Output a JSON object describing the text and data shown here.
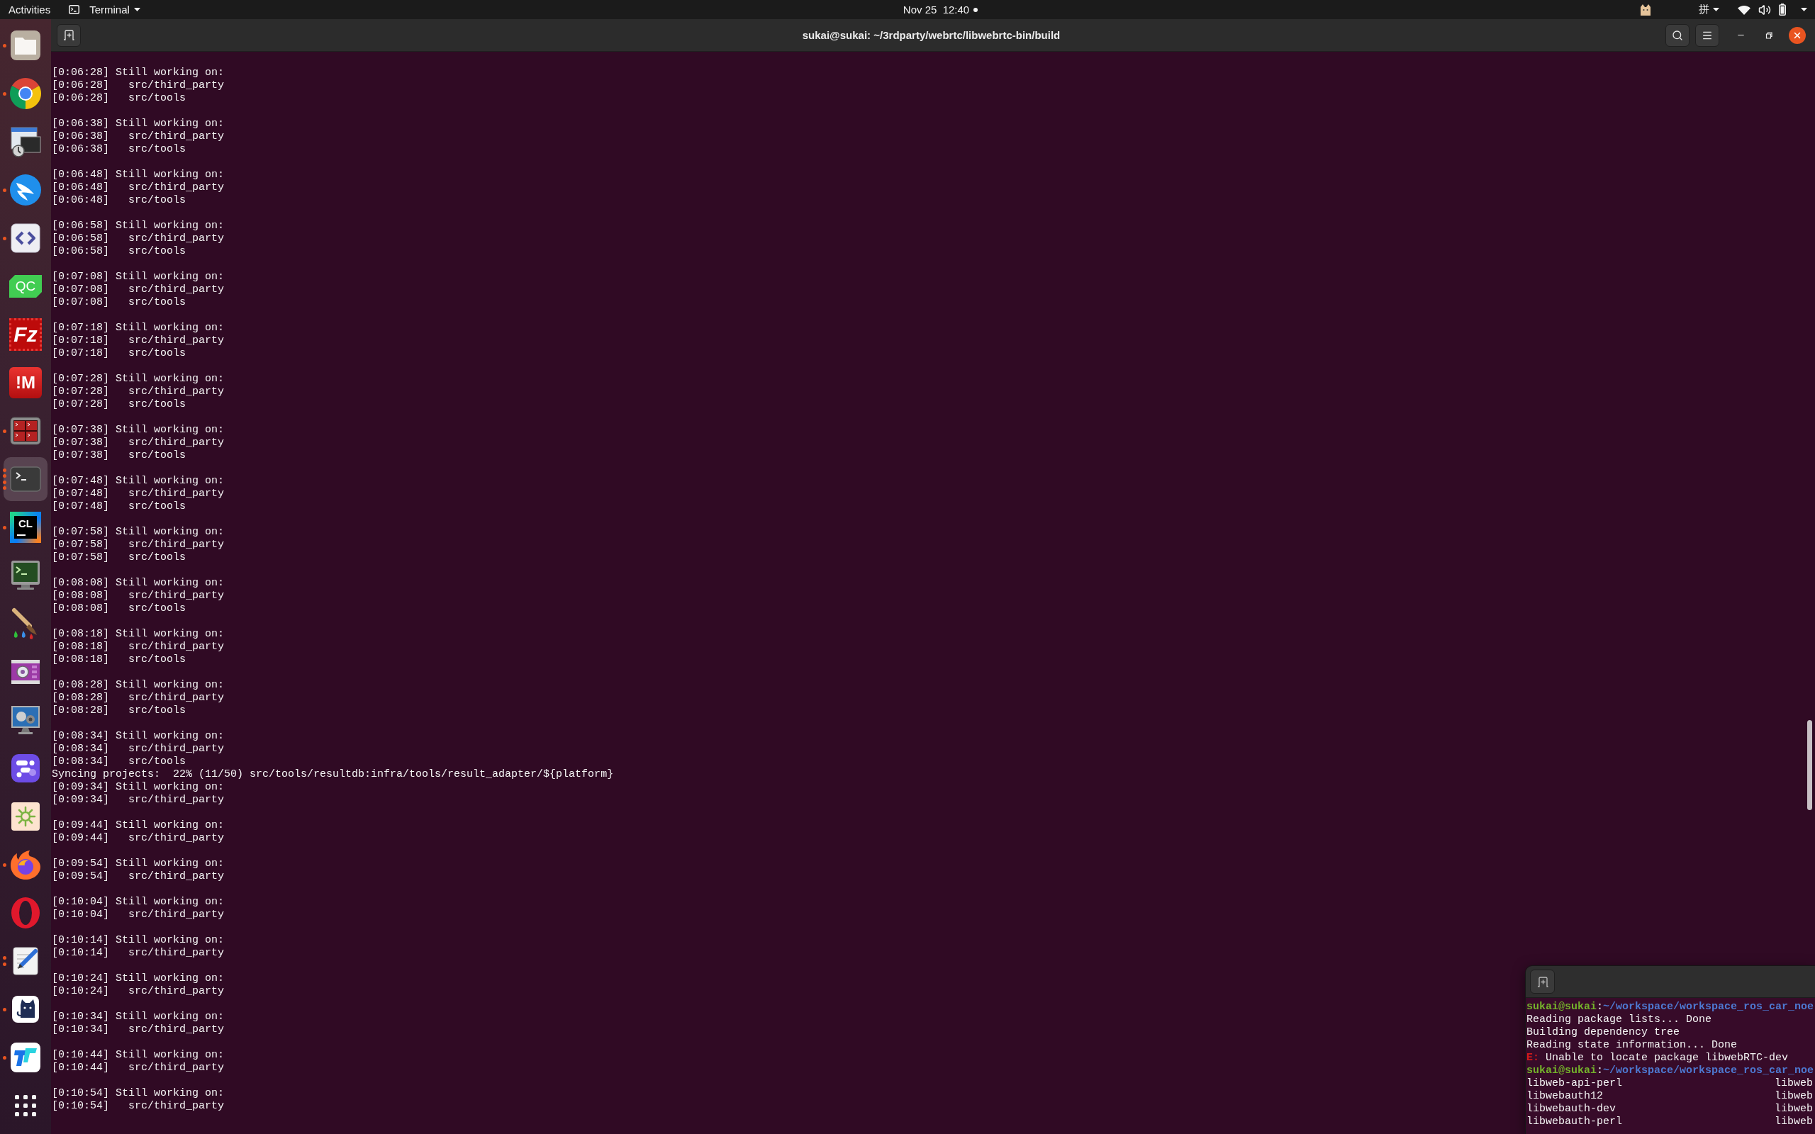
{
  "top_bar": {
    "activities": "Activities",
    "app_menu": "Terminal",
    "clock": "Nov 25  12:40",
    "notifications": true,
    "input_method": "拼"
  },
  "dock": {
    "items": [
      {
        "selected": false,
        "dots": [
          true
        ]
      },
      {
        "selected": false,
        "dots": [
          true
        ]
      },
      {
        "selected": false,
        "dots": [
          false
        ]
      },
      {
        "selected": false,
        "dots": [
          true
        ]
      },
      {
        "selected": false,
        "dots": [
          true
        ]
      },
      {
        "logo": "QC",
        "selected": false,
        "dots": [
          false
        ]
      },
      {
        "logo": "Fz",
        "selected": false,
        "dots": [
          false
        ]
      },
      {
        "logo": "!M",
        "selected": false,
        "dots": [
          false
        ]
      },
      {
        "selected": false,
        "dots": [
          true
        ]
      },
      {
        "selected": true,
        "dots": [
          true,
          true,
          true,
          true
        ]
      },
      {
        "logo": "CL",
        "selected": false,
        "dots": [
          true
        ]
      },
      {
        "selected": false,
        "dots": [
          false
        ]
      },
      {
        "selected": false,
        "dots": [
          false
        ]
      },
      {
        "selected": false,
        "dots": [
          false
        ]
      },
      {
        "selected": false,
        "dots": [
          false
        ]
      },
      {
        "selected": false,
        "dots": [
          false
        ]
      },
      {
        "selected": false,
        "dots": [
          false
        ]
      },
      {
        "selected": false,
        "dots": [
          true
        ]
      },
      {
        "selected": false,
        "dots": [
          false
        ]
      },
      {
        "selected": false,
        "dots": [
          true,
          true
        ]
      },
      {
        "selected": false,
        "dots": [
          true
        ]
      },
      {
        "selected": false,
        "dots": [
          true
        ]
      }
    ]
  },
  "terminal": {
    "title": "sukai@sukai: ~/3rdparty/webrtc/libwebrtc-bin/build",
    "blocks": [
      {
        "lines": [
          "[0:06:28] Still working on:",
          "[0:06:28]   src/third_party",
          "[0:06:28]   src/tools"
        ]
      },
      {
        "lines": [
          "[0:06:38] Still working on:",
          "[0:06:38]   src/third_party",
          "[0:06:38]   src/tools"
        ]
      },
      {
        "lines": [
          "[0:06:48] Still working on:",
          "[0:06:48]   src/third_party",
          "[0:06:48]   src/tools"
        ]
      },
      {
        "lines": [
          "[0:06:58] Still working on:",
          "[0:06:58]   src/third_party",
          "[0:06:58]   src/tools"
        ]
      },
      {
        "lines": [
          "[0:07:08] Still working on:",
          "[0:07:08]   src/third_party",
          "[0:07:08]   src/tools"
        ]
      },
      {
        "lines": [
          "[0:07:18] Still working on:",
          "[0:07:18]   src/third_party",
          "[0:07:18]   src/tools"
        ]
      },
      {
        "lines": [
          "[0:07:28] Still working on:",
          "[0:07:28]   src/third_party",
          "[0:07:28]   src/tools"
        ]
      },
      {
        "lines": [
          "[0:07:38] Still working on:",
          "[0:07:38]   src/third_party",
          "[0:07:38]   src/tools"
        ]
      },
      {
        "lines": [
          "[0:07:48] Still working on:",
          "[0:07:48]   src/third_party",
          "[0:07:48]   src/tools"
        ]
      },
      {
        "lines": [
          "[0:07:58] Still working on:",
          "[0:07:58]   src/third_party",
          "[0:07:58]   src/tools"
        ]
      },
      {
        "lines": [
          "[0:08:08] Still working on:",
          "[0:08:08]   src/third_party",
          "[0:08:08]   src/tools"
        ]
      },
      {
        "lines": [
          "[0:08:18] Still working on:",
          "[0:08:18]   src/third_party",
          "[0:08:18]   src/tools"
        ]
      },
      {
        "lines": [
          "[0:08:28] Still working on:",
          "[0:08:28]   src/third_party",
          "[0:08:28]   src/tools"
        ]
      },
      {
        "lines": [
          "[0:08:34] Still working on:",
          "[0:08:34]   src/third_party",
          "[0:08:34]   src/tools",
          "Syncing projects:  22% (11/50) src/tools/resultdb:infra/tools/result_adapter/${platform}",
          "[0:09:34] Still working on:",
          "[0:09:34]   src/third_party"
        ]
      },
      {
        "lines": [
          "[0:09:44] Still working on:",
          "[0:09:44]   src/third_party"
        ]
      },
      {
        "lines": [
          "[0:09:54] Still working on:",
          "[0:09:54]   src/third_party"
        ]
      },
      {
        "lines": [
          "[0:10:04] Still working on:",
          "[0:10:04]   src/third_party"
        ]
      },
      {
        "lines": [
          "[0:10:14] Still working on:",
          "[0:10:14]   src/third_party"
        ]
      },
      {
        "lines": [
          "[0:10:24] Still working on:",
          "[0:10:24]   src/third_party"
        ]
      },
      {
        "lines": [
          "[0:10:34] Still working on:",
          "[0:10:34]   src/third_party"
        ]
      },
      {
        "lines": [
          "[0:10:44] Still working on:",
          "[0:10:44]   src/third_party"
        ]
      },
      {
        "lines": [
          "[0:10:54] Still working on:",
          "[0:10:54]   src/third_party"
        ]
      }
    ]
  },
  "second_terminal": {
    "lines": [
      {
        "kind": "prompt",
        "user": "sukai@sukai",
        "separator": ":",
        "path": "~/workspace/workspace_ros_car_noe"
      },
      {
        "kind": "output",
        "text": "Reading package lists... Done"
      },
      {
        "kind": "output",
        "text": "Building dependency tree"
      },
      {
        "kind": "output",
        "text": "Reading state information... Done"
      },
      {
        "kind": "error",
        "label": "E:",
        "text": "Unable to locate package libwebRTC-dev"
      },
      {
        "kind": "prompt",
        "user": "sukai@sukai",
        "separator": ":",
        "path": "~/workspace/workspace_ros_car_noe"
      },
      {
        "kind": "columns",
        "cells": [
          "libweb-api-perl",
          "libweb"
        ]
      },
      {
        "kind": "columns",
        "cells": [
          "libwebauth12",
          "libweb"
        ]
      },
      {
        "kind": "columns",
        "cells": [
          "libwebauth-dev",
          "libweb"
        ]
      },
      {
        "kind": "columns",
        "cells": [
          "libwebauth-perl",
          "libweb"
        ]
      }
    ]
  }
}
